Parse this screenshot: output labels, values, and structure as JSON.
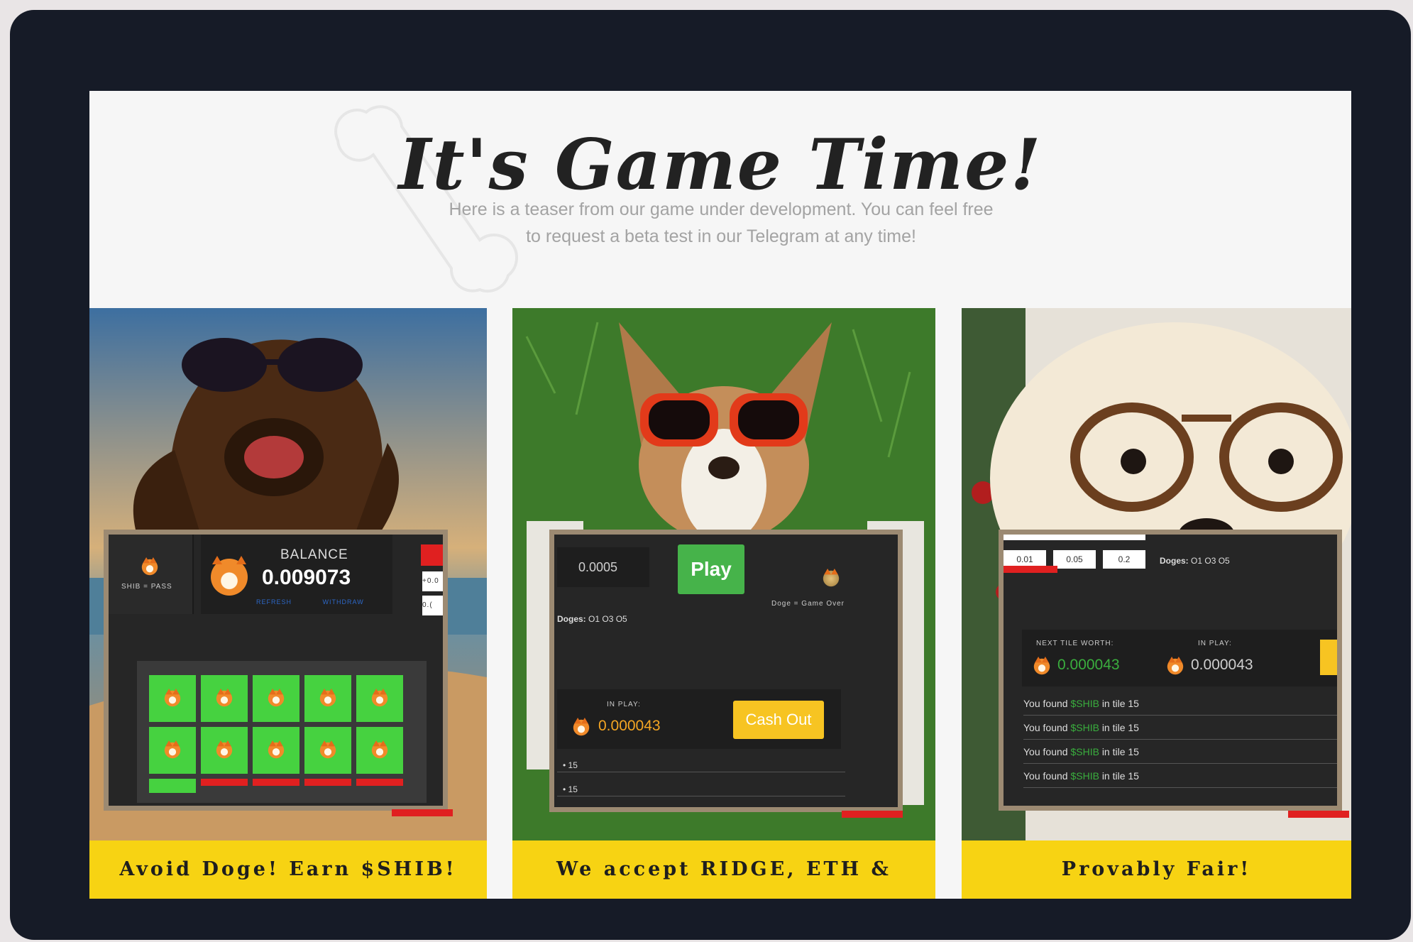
{
  "heading": {
    "title": "It's Game Time!",
    "subtitle_line1": "Here is a teaser from our game under development. You can feel free",
    "subtitle_line2": "to request a beta test in our Telegram at any time!"
  },
  "colors": {
    "frame": "#161b27",
    "banner": "#f7d313",
    "tile_green": "#46d240",
    "play_green": "#46b34a",
    "cashout_yellow": "#f7c422",
    "panel_border": "#9c8a72"
  },
  "cards": [
    {
      "banner": "Avoid Doge! Earn $SHIB!",
      "panel": {
        "shib_pass_label": "SHIB = PASS",
        "balance_label": "BALANCE",
        "balance_value": "0.009073",
        "refresh_label": "REFRESH",
        "withdraw_label": "WITHDRAW",
        "side_value": "+0.0",
        "side_value2": "0.("
      }
    },
    {
      "banner": "We accept RIDGE, ETH & SHIB!",
      "panel": {
        "bet_value": "0.0005",
        "play_label": "Play",
        "doges_label": "Doges:",
        "doges_options": "O1 O3 O5",
        "doge_gameover": "Doge = Game Over",
        "in_play_label": "IN PLAY:",
        "in_play_value": "0.000043",
        "cashout_label": "Cash Out",
        "row1": "15",
        "row2": "15"
      }
    },
    {
      "banner": "Provably Fair!",
      "panel": {
        "bet_opt1": "0.01",
        "bet_opt2": "0.05",
        "bet_opt3": "0.2",
        "doges_label": "Doges:",
        "doges_options": "O1 O3 O5",
        "next_tile_label": "NEXT TILE WORTH:",
        "next_tile_value": "0.000043",
        "in_play_label": "IN PLAY:",
        "in_play_value": "0.000043",
        "log": [
          {
            "pre": "You found",
            "hl": "$SHIB",
            "post": "in tile 15"
          },
          {
            "pre": "You found",
            "hl": "$SHIB",
            "post": "in tile 15"
          },
          {
            "pre": "You found",
            "hl": "$SHIB",
            "post": "in tile 15"
          },
          {
            "pre": "You found",
            "hl": "$SHIB",
            "post": "in tile 15"
          }
        ]
      }
    }
  ]
}
